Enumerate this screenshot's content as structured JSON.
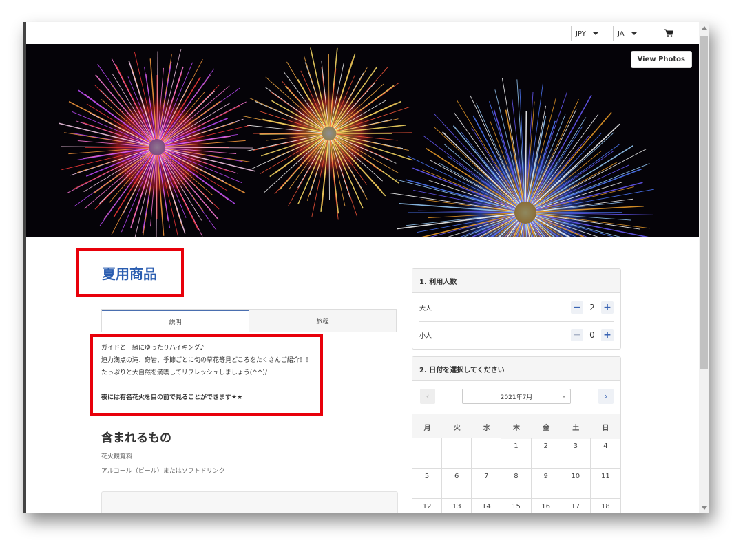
{
  "header": {
    "currency": "JPY",
    "language": "JA"
  },
  "hero": {
    "view_photos_label": "View Photos"
  },
  "product": {
    "title": "夏用商品",
    "tabs": [
      "説明",
      "旅程"
    ],
    "description_lines": [
      "ガイドと一緒にゆったりハイキング♪",
      "迫力満点の滝、奇岩、季節ごとに旬の草花等見どころをたくさんご紹介！！",
      "たっぷりと大自然を満喫してリフレッシュしましょう(^^)/"
    ],
    "description_highlight": "夜には有名花火を目の前で見ることができます★★",
    "includes_title": "含まれるもの",
    "includes": [
      "花火観覧料",
      "アルコール（ビール）またはソフトドリンク"
    ]
  },
  "booking": {
    "participants_title": "1. 利用人数",
    "adult_label": "大人",
    "adult_count": "2",
    "child_label": "小人",
    "child_count": "0",
    "minus": "−",
    "plus": "+",
    "date_title": "2. 日付を選択してください",
    "month": "2021年7月",
    "prev": "‹",
    "next": "›",
    "weekdays": [
      "月",
      "火",
      "水",
      "木",
      "金",
      "土",
      "日"
    ],
    "days": [
      "",
      "",
      "",
      "1",
      "2",
      "3",
      "4",
      "5",
      "6",
      "7",
      "8",
      "9",
      "10",
      "11",
      "12",
      "13",
      "14",
      "15",
      "16",
      "17",
      "18"
    ]
  },
  "colors": {
    "accent": "#2a5db0",
    "highlight_box": "#e8000a"
  }
}
